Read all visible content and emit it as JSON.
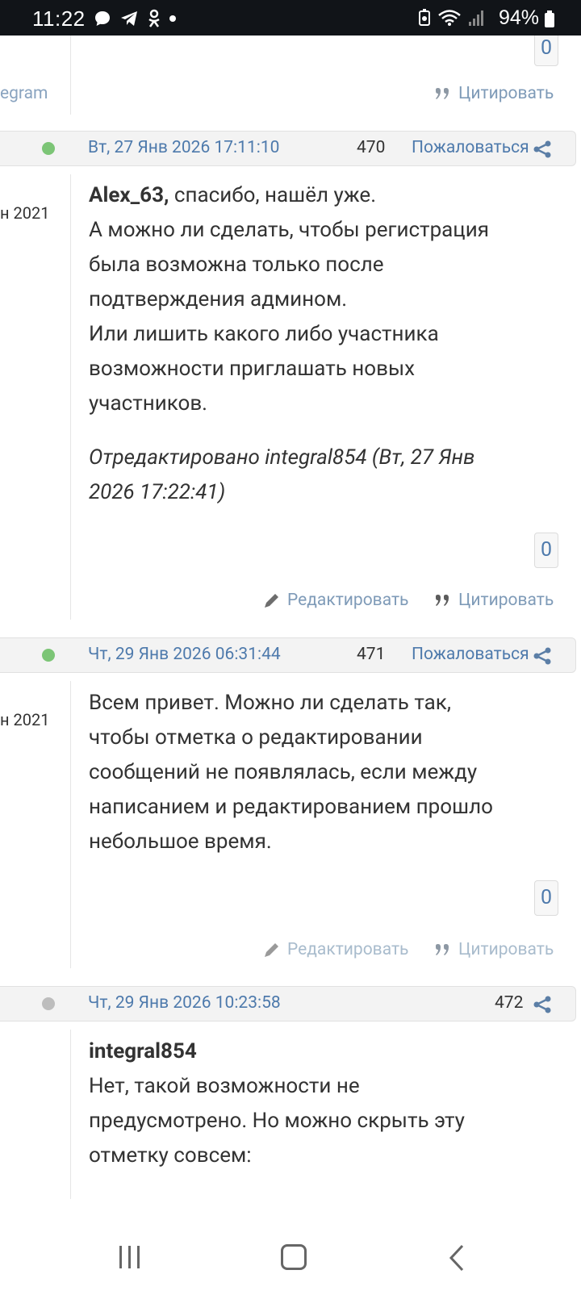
{
  "status_bar": {
    "time": "11:22",
    "battery": "94%"
  },
  "top_fragment": {
    "left_text": "egram",
    "rating": "0",
    "quote_label": "Цитировать"
  },
  "posts": [
    {
      "date": "Вт, 27 Янв 2026 17:11:10",
      "number": "470",
      "report_label": "Пожаловаться",
      "status": "online",
      "reg_date": "н 2021",
      "author_ref": "Alex_63,",
      "text": "спасибо, нашёл уже.",
      "text_lines": [
        "А можно ли сделать, чтобы регистрация",
        "была возможна только после",
        "подтверждения админом.",
        "Или лишить какого либо участника",
        "возможности приглашать новых",
        "участников."
      ],
      "edited_line1": "Отредактировано integral854 (Вт, 27 Янв",
      "edited_line2": "2026 17:22:41)",
      "rating": "0",
      "edit_label": "Редактировать",
      "quote_label": "Цитировать"
    },
    {
      "date": "Чт, 29 Янв 2026 06:31:44",
      "number": "471",
      "report_label": "Пожаловаться",
      "status": "online",
      "reg_date": "н 2021",
      "text_lines": [
        "Всем привет. Можно ли сделать так,",
        "чтобы отметка о редактировании",
        "сообщений не появлялась, если между",
        "написанием и редактированием прошло",
        "небольшое время."
      ],
      "rating": "0",
      "edit_label": "Редактировать",
      "quote_label": "Цитировать"
    },
    {
      "date": "Чт, 29 Янв 2026 10:23:58",
      "number": "472",
      "status": "offline",
      "author_ref": "integral854",
      "text_lines": [
        "Нет, такой возможности не",
        "предусмотрено. Но можно скрыть эту",
        "отметку совсем:"
      ]
    }
  ],
  "colors": {
    "online": "#7cc576",
    "offline": "#bdbdbd",
    "link": "#4e7aac",
    "muted_link": "#7f9bb8"
  },
  "icons": [
    "chat-icon",
    "telegram-icon",
    "odnoklassniki-icon",
    "battery-icon",
    "wifi-icon",
    "signal-icon",
    "share-icon",
    "pencil-icon",
    "quote-icon"
  ]
}
